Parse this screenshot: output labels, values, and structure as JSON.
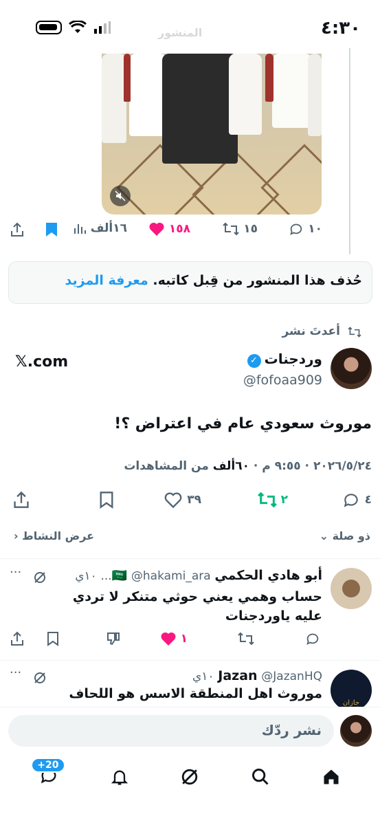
{
  "status_bar": {
    "time": "٤:٣٠",
    "faded_header": "المنشور"
  },
  "quoted_post": {
    "actions": {
      "reply": "١٠",
      "retweet": "١٥",
      "likes": "١٥٨",
      "views": "١٦ألف"
    },
    "removed_notice": "حُذف هذا المنشور من قِبل كاتبه.",
    "learn_more": "معرفة المزيد"
  },
  "reposted_label": "أعدتَ نشر",
  "main_post": {
    "author_name": "وردجنات",
    "author_handle": "@fofoaa909",
    "source": "𝕏.com",
    "text": "موروث سعودي عام في اعتراض ؟!",
    "meta_date": "٢٠٢٦/٥/٢٤ · ٩:٥٥ م · ",
    "meta_views_num": "٦٠ألف",
    "meta_views_label": " من المشاهدات",
    "actions": {
      "reply": "٤",
      "retweet": "٢",
      "likes": "٣٩"
    }
  },
  "replies_header": {
    "sort": "ذو صلة",
    "activity": "عرض النشاط"
  },
  "replies": [
    {
      "name": "أبو هادي الحكمي",
      "flag": "🇸🇦",
      "handle": "@hakami_ara...",
      "time": "١٠ي",
      "text": "حساب وهمي يعني حوثي متنكر لا تردي عليه ياوردجنات",
      "likes": "١"
    },
    {
      "name": "Jazan",
      "handle": "@JazanHQ",
      "time": "١٠ي",
      "text": "موروث اهل المنطقة الاسس هو اللحاف",
      "avatar_text": "جازان"
    }
  ],
  "composer": {
    "placeholder": "نشر ردّك"
  },
  "bottom_nav": {
    "badge": "+20"
  },
  "colors": {
    "accent": "#1d9bf0",
    "like": "#f91880",
    "retweet": "#00ba7c",
    "muted": "#536471"
  }
}
